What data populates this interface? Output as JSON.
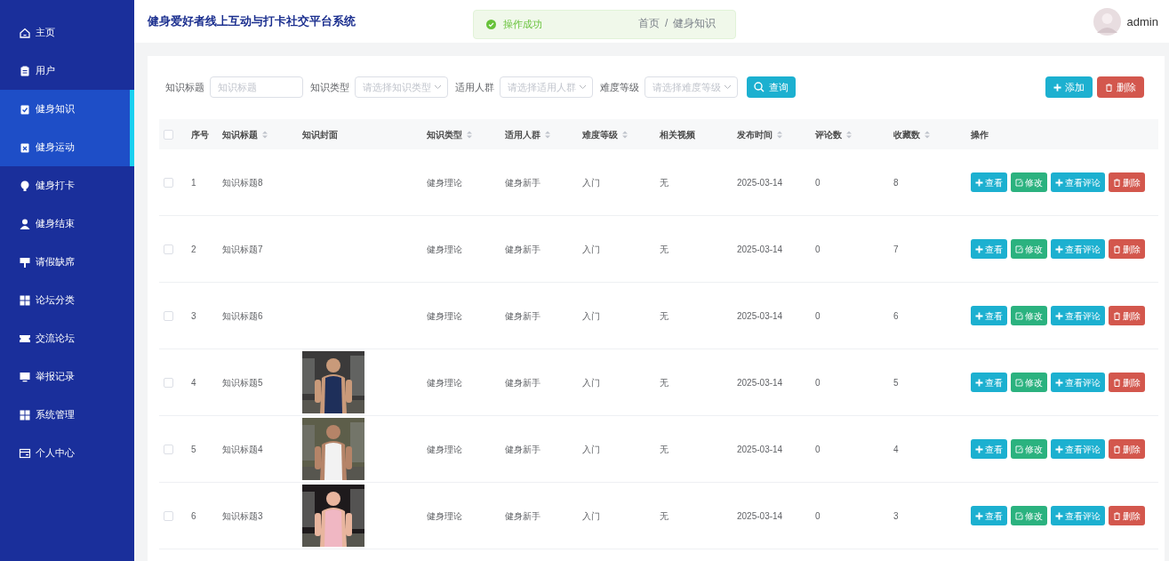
{
  "sidebar": {
    "items": [
      {
        "label": "主页",
        "highlighted": false
      },
      {
        "label": "用户",
        "highlighted": false
      },
      {
        "label": "健身知识",
        "highlighted": true
      },
      {
        "label": "健身运动",
        "highlighted": true
      },
      {
        "label": "健身打卡",
        "highlighted": false
      },
      {
        "label": "健身结束",
        "highlighted": false
      },
      {
        "label": "请假缺席",
        "highlighted": false
      },
      {
        "label": "论坛分类",
        "highlighted": false
      },
      {
        "label": "交流论坛",
        "highlighted": false
      },
      {
        "label": "举报记录",
        "highlighted": false
      },
      {
        "label": "系统管理",
        "highlighted": false
      },
      {
        "label": "个人中心",
        "highlighted": false
      }
    ]
  },
  "header": {
    "title": "健身爱好者线上互动与打卡社交平台系统",
    "breadcrumb": [
      "首页",
      "/",
      "健身知识"
    ],
    "toast": "操作成功",
    "user": "admin"
  },
  "filters": [
    {
      "label": "知识标题",
      "kind": "input",
      "placeholder": "知识标题"
    },
    {
      "label": "知识类型",
      "kind": "select",
      "placeholder": "请选择知识类型"
    },
    {
      "label": "适用人群",
      "kind": "select",
      "placeholder": "请选择适用人群"
    },
    {
      "label": "难度等级",
      "kind": "select",
      "placeholder": "请选择难度等级"
    }
  ],
  "search_button": "查询",
  "toolbar": [
    {
      "label": "添加",
      "kind": "add"
    },
    {
      "label": "删除",
      "kind": "delete"
    }
  ],
  "table": {
    "all_checked": false,
    "columns": [
      {
        "label": "序号",
        "sortable": false
      },
      {
        "label": "知识标题",
        "sortable": true
      },
      {
        "label": "知识封面",
        "sortable": false
      },
      {
        "label": "知识类型",
        "sortable": true
      },
      {
        "label": "适用人群",
        "sortable": true
      },
      {
        "label": "难度等级",
        "sortable": true
      },
      {
        "label": "相关视频",
        "sortable": false
      },
      {
        "label": "发布时间",
        "sortable": true
      },
      {
        "label": "评论数",
        "sortable": true
      },
      {
        "label": "收藏数",
        "sortable": true
      },
      {
        "label": "操作",
        "sortable": false
      }
    ],
    "rows": [
      {
        "checked": false,
        "cells": [
          "1",
          "知识标题8",
          null,
          "健身理论",
          "健身新手",
          "入门",
          "无",
          "2025-03-14",
          "0",
          "8"
        ],
        "actions": [
          {
            "label": "查看",
            "kind": "view"
          },
          {
            "label": "修改",
            "kind": "edit"
          },
          {
            "label": "查看评论",
            "kind": "view"
          },
          {
            "label": "删除",
            "kind": "delete"
          }
        ]
      },
      {
        "checked": false,
        "cells": [
          "2",
          "知识标题7",
          null,
          "健身理论",
          "健身新手",
          "入门",
          "无",
          "2025-03-14",
          "0",
          "7"
        ],
        "actions": [
          {
            "label": "查看",
            "kind": "view"
          },
          {
            "label": "修改",
            "kind": "edit"
          },
          {
            "label": "查看评论",
            "kind": "view"
          },
          {
            "label": "删除",
            "kind": "delete"
          }
        ]
      },
      {
        "checked": false,
        "cells": [
          "3",
          "知识标题6",
          null,
          "健身理论",
          "健身新手",
          "入门",
          "无",
          "2025-03-14",
          "0",
          "6"
        ],
        "actions": [
          {
            "label": "查看",
            "kind": "view"
          },
          {
            "label": "修改",
            "kind": "edit"
          },
          {
            "label": "查看评论",
            "kind": "view"
          },
          {
            "label": "删除",
            "kind": "delete"
          }
        ]
      },
      {
        "checked": false,
        "cells": [
          "4",
          "知识标题5",
          {
            "kind": "picture"
          },
          "健身理论",
          "健身新手",
          "入门",
          "无",
          "2025-03-14",
          "0",
          "5"
        ],
        "actions": [
          {
            "label": "查看",
            "kind": "view"
          },
          {
            "label": "修改",
            "kind": "edit"
          },
          {
            "label": "查看评论",
            "kind": "view"
          },
          {
            "label": "删除",
            "kind": "delete"
          }
        ]
      },
      {
        "checked": false,
        "cells": [
          "5",
          "知识标题4",
          {
            "kind": "picture"
          },
          "健身理论",
          "健身新手",
          "入门",
          "无",
          "2025-03-14",
          "0",
          "4"
        ],
        "actions": [
          {
            "label": "查看",
            "kind": "view"
          },
          {
            "label": "修改",
            "kind": "edit"
          },
          {
            "label": "查看评论",
            "kind": "view"
          },
          {
            "label": "删除",
            "kind": "delete"
          }
        ]
      },
      {
        "checked": false,
        "cells": [
          "6",
          "知识标题3",
          {
            "kind": "picture"
          },
          "健身理论",
          "健身新手",
          "入门",
          "无",
          "2025-03-14",
          "0",
          "3"
        ],
        "actions": [
          {
            "label": "查看",
            "kind": "view"
          },
          {
            "label": "修改",
            "kind": "edit"
          },
          {
            "label": "查看评论",
            "kind": "view"
          },
          {
            "label": "删除",
            "kind": "delete"
          }
        ]
      }
    ]
  }
}
